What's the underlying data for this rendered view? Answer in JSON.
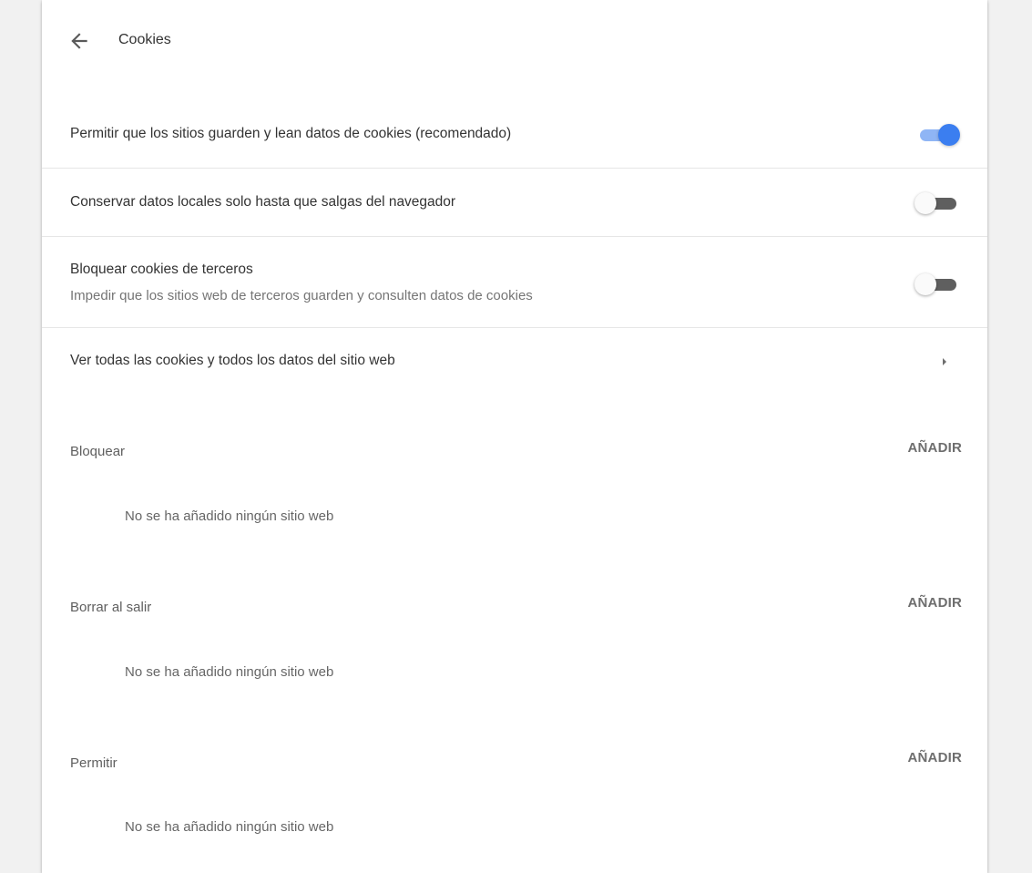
{
  "header": {
    "title": "Cookies",
    "back_icon": "arrow-back-icon"
  },
  "settings": [
    {
      "label": "Permitir que los sitios guarden y lean datos de cookies (recomendado)",
      "toggle": "on"
    },
    {
      "label": "Conservar datos locales solo hasta que salgas del navegador",
      "toggle": "off"
    },
    {
      "label": "Bloquear cookies de terceros",
      "sublabel": "Impedir que los sitios web de terceros guarden y consulten datos de cookies",
      "toggle": "off"
    }
  ],
  "view_all": {
    "label": "Ver todas las cookies y todos los datos del sitio web",
    "icon": "arrow-right-icon"
  },
  "sections": [
    {
      "title": "Bloquear",
      "add_label": "AÑADIR",
      "empty_message": "No se ha añadido ningún sitio web"
    },
    {
      "title": "Borrar al salir",
      "add_label": "AÑADIR",
      "empty_message": "No se ha añadido ningún sitio web"
    },
    {
      "title": "Permitir",
      "add_label": "AÑADIR",
      "empty_message": "No se ha añadido ningún sitio web"
    }
  ],
  "colors": {
    "accent": "#3b7ef0",
    "accent_track": "#8fb5f5",
    "background": "#f1f1f1",
    "card": "#ffffff"
  }
}
